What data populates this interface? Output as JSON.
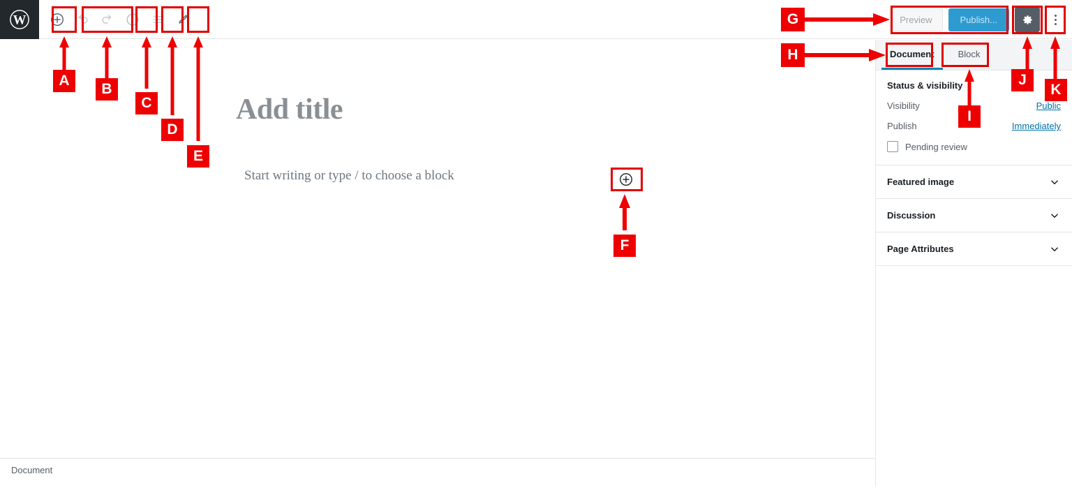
{
  "app": {
    "logo_icon": "wordpress-logo-icon"
  },
  "toolbar": {
    "left_buttons": [
      {
        "name": "block-inserter-button",
        "icon": "plus-circle-icon",
        "label": "Add block"
      },
      {
        "name": "undo-button",
        "icon": "undo-arrow-icon",
        "label": "Undo"
      },
      {
        "name": "redo-button",
        "icon": "redo-arrow-icon",
        "label": "Redo"
      },
      {
        "name": "content-structure-button",
        "icon": "info-circle-icon",
        "label": "Content structure"
      },
      {
        "name": "block-navigation-button",
        "icon": "list-view-icon",
        "label": "Block navigation"
      },
      {
        "name": "edit-mode-button",
        "icon": "pencil-icon",
        "label": "Edit"
      }
    ],
    "preview_label": "Preview",
    "publish_label": "Publish...",
    "settings_icon": "gear-icon",
    "more_menu_icon": "kebab-menu-icon"
  },
  "editor": {
    "title_placeholder": "Add title",
    "block_placeholder": "Start writing or type / to choose a block",
    "inline_inserter_icon": "plus-circle-icon",
    "breadcrumb": "Document"
  },
  "sidebar": {
    "tabs": [
      {
        "label": "Document",
        "active": true
      },
      {
        "label": "Block",
        "active": false
      }
    ],
    "status_panel": {
      "title": "Status & visibility",
      "rows": [
        {
          "label": "Visibility",
          "value": "Public"
        },
        {
          "label": "Publish",
          "value": "Immediately"
        }
      ],
      "checkbox_label": "Pending review",
      "checkbox_checked": false
    },
    "collapsibles": [
      {
        "label": "Featured image",
        "icon": "chevron-down-icon"
      },
      {
        "label": "Discussion",
        "icon": "chevron-down-icon"
      },
      {
        "label": "Page Attributes",
        "icon": "chevron-down-icon"
      }
    ]
  },
  "annotations": {
    "accent_color": "#ee0000",
    "markers": [
      {
        "id": "A",
        "target": "block-inserter-button",
        "direction": "up"
      },
      {
        "id": "B",
        "target": "undo-redo-group",
        "direction": "up"
      },
      {
        "id": "C",
        "target": "content-structure-button",
        "direction": "up"
      },
      {
        "id": "D",
        "target": "block-navigation-button",
        "direction": "up"
      },
      {
        "id": "E",
        "target": "edit-mode-button",
        "direction": "up"
      },
      {
        "id": "F",
        "target": "inline-block-inserter",
        "direction": "up"
      },
      {
        "id": "G",
        "target": "preview-publish-group",
        "direction": "right"
      },
      {
        "id": "H",
        "target": "document-tab",
        "direction": "right"
      },
      {
        "id": "I",
        "target": "block-tab",
        "direction": "up"
      },
      {
        "id": "J",
        "target": "settings-gear-button",
        "direction": "up"
      },
      {
        "id": "K",
        "target": "more-menu-button",
        "direction": "up"
      }
    ]
  }
}
